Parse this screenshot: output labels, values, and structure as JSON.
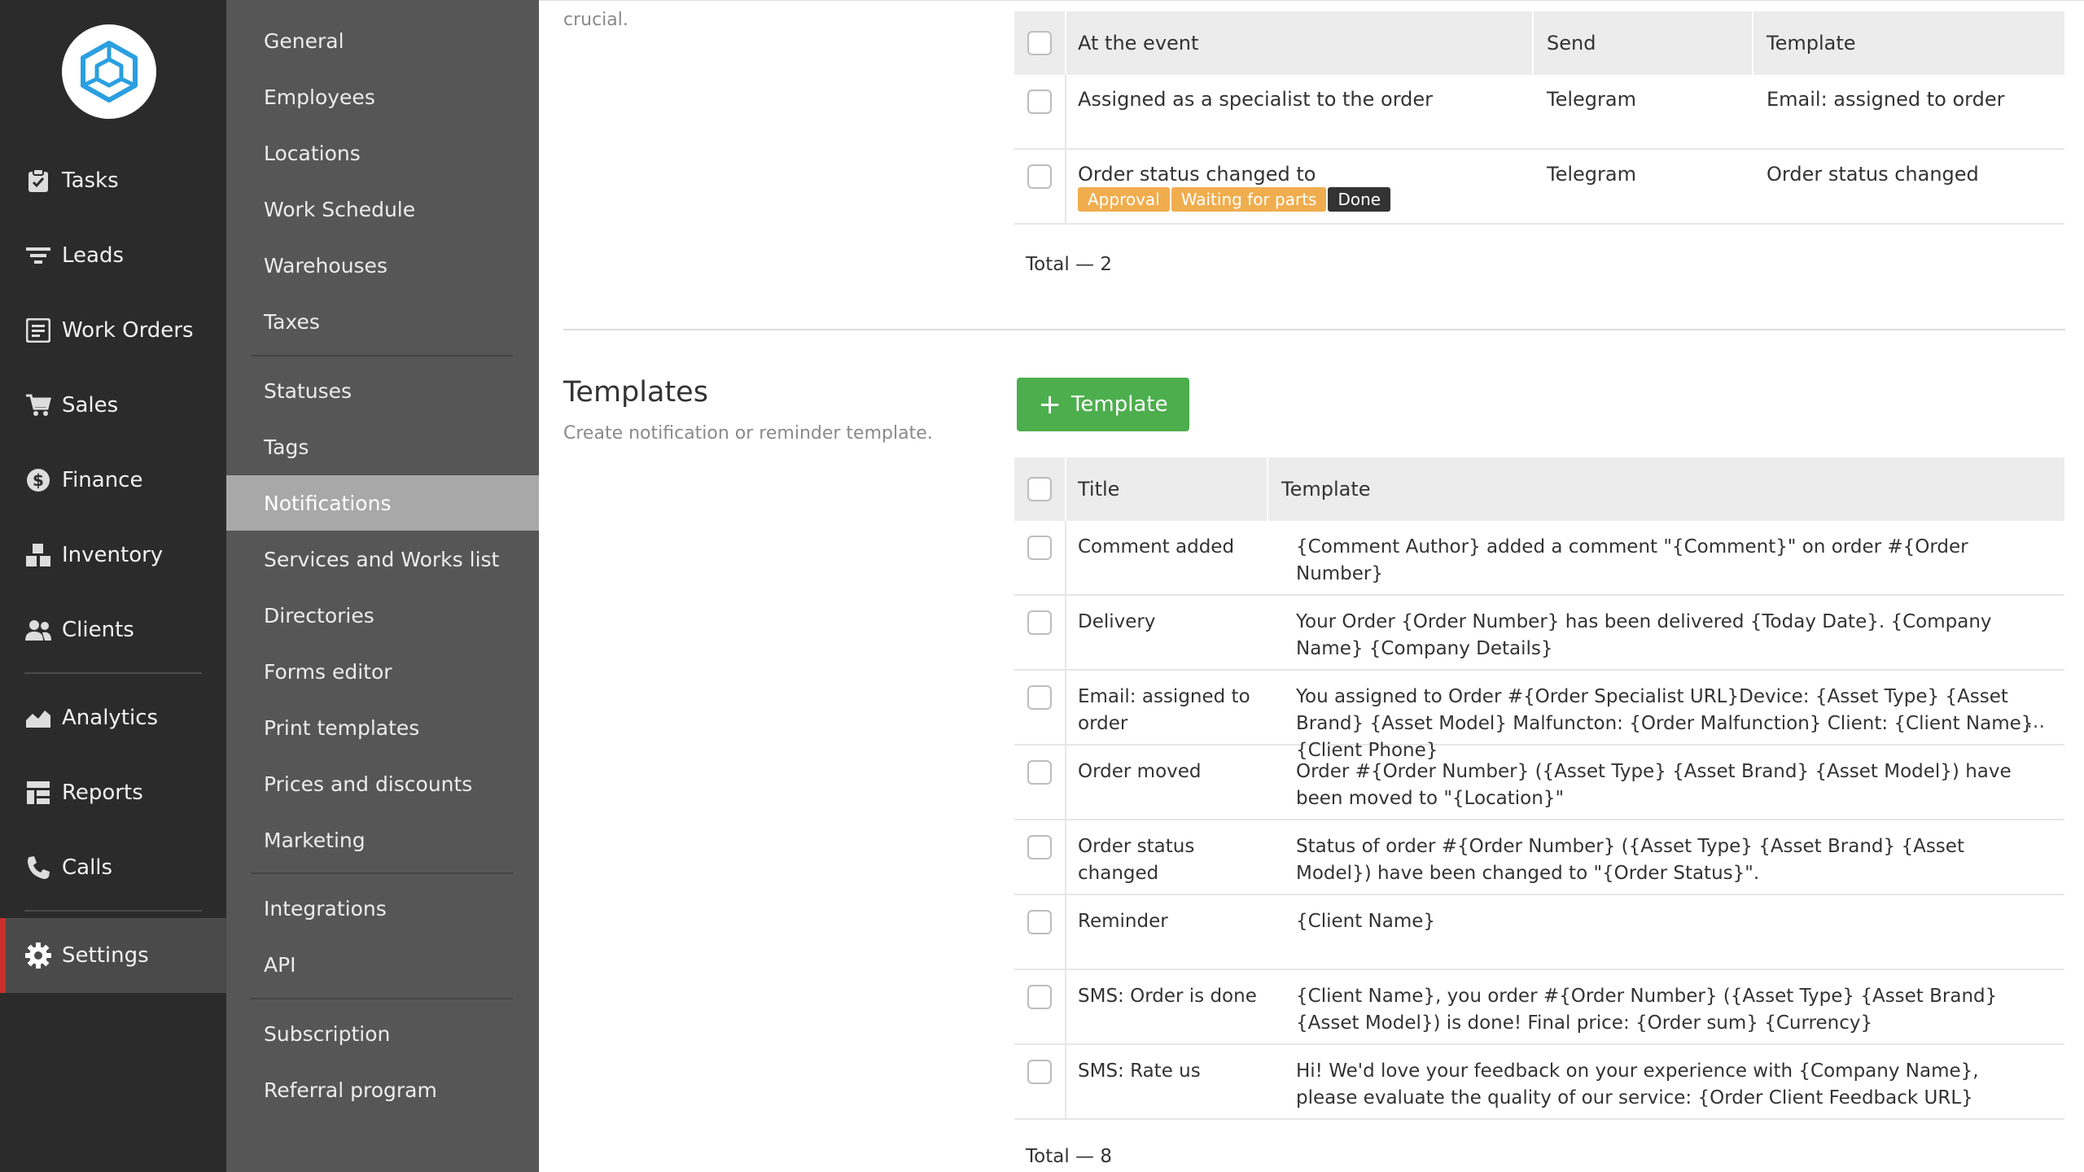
{
  "nav": {
    "items": [
      {
        "label": "Tasks",
        "icon": "clipboard-icon"
      },
      {
        "label": "Leads",
        "icon": "filter-icon"
      },
      {
        "label": "Work Orders",
        "icon": "work-orders-icon"
      },
      {
        "label": "Sales",
        "icon": "cart-icon"
      },
      {
        "label": "Finance",
        "icon": "dollar-icon"
      },
      {
        "label": "Inventory",
        "icon": "boxes-icon"
      },
      {
        "label": "Clients",
        "icon": "people-icon"
      },
      {
        "label": "Analytics",
        "icon": "area-chart-icon"
      },
      {
        "label": "Reports",
        "icon": "reports-icon"
      },
      {
        "label": "Calls",
        "icon": "phone-icon"
      },
      {
        "label": "Settings",
        "icon": "gear-icon"
      }
    ],
    "active": "Settings"
  },
  "settings_menu": {
    "items": [
      "General",
      "Employees",
      "Locations",
      "Work Schedule",
      "Warehouses",
      "Taxes",
      "Statuses",
      "Tags",
      "Notifications",
      "Services and Works list",
      "Directories",
      "Forms editor",
      "Print templates",
      "Prices and discounts",
      "Marketing",
      "Integrations",
      "API",
      "Subscription",
      "Referral program"
    ],
    "active": "Notifications"
  },
  "content": {
    "crucial_text": "crucial.",
    "notifications_table": {
      "headers": [
        "At the event",
        "Send",
        "Template"
      ],
      "rows": [
        {
          "event": "Assigned as a specialist to the order",
          "send": "Telegram",
          "template": "Email: assigned to order"
        },
        {
          "event": "Order status changed to",
          "send": "Telegram",
          "template": "Order status changed",
          "tags": [
            {
              "label": "Approval",
              "color": "#f0ad4e"
            },
            {
              "label": "Waiting for parts",
              "color": "#f0ad4e"
            },
            {
              "label": "Done",
              "color": "#333333"
            }
          ]
        }
      ],
      "total": "Total — 2"
    },
    "templates": {
      "title": "Templates",
      "subtitle": "Create notification or reminder template.",
      "add_button": "Template",
      "headers": [
        "Title",
        "Template"
      ],
      "rows": [
        {
          "title": "Comment added",
          "template": "{Comment Author} added a comment \"{Comment}\" on order #{Order Number}"
        },
        {
          "title": "Delivery",
          "template": "Your Order {Order Number} has been delivered {Today Date}. {Company Name} {Company Details}"
        },
        {
          "title": "Email: assigned to order",
          "template": "You assigned to Order #{Order Specialist URL}Device: {Asset Type} {Asset Brand} {Asset Model} Malfuncton: {Order Malfunction} Client: {Client Name} {Client Phone}",
          "truncated": "..."
        },
        {
          "title": "Order moved",
          "template": "Order #{Order Number} ({Asset Type} {Asset Brand} {Asset Model}) have been moved to \"{Location}\""
        },
        {
          "title": "Order status changed",
          "template": "Status of order #{Order Number} ({Asset Type} {Asset Brand} {Asset Model}) have been changed to \"{Order Status}\"."
        },
        {
          "title": "Reminder",
          "template": "{Client Name}"
        },
        {
          "title": "SMS: Order is done",
          "template": "{Client Name}, you order #{Order Number} ({Asset Type} {Asset Brand} {Asset Model}) is done! Final price: {Order sum} {Currency}"
        },
        {
          "title": "SMS: Rate us",
          "template": "Hi! We'd love your feedback on your experience with {Company Name}, please evaluate the quality of our service: {Order Client Feedback URL}"
        }
      ],
      "total": "Total — 8"
    }
  },
  "colors": {
    "nav_bg": "#2b2b2b",
    "sub_bg": "#565656",
    "active_sub": "#a8a8a8",
    "accent_red": "#c9302c",
    "button_green": "#4cae4c",
    "link_blue": "#2a7fc1",
    "logo_blue": "#2b9fe0"
  }
}
